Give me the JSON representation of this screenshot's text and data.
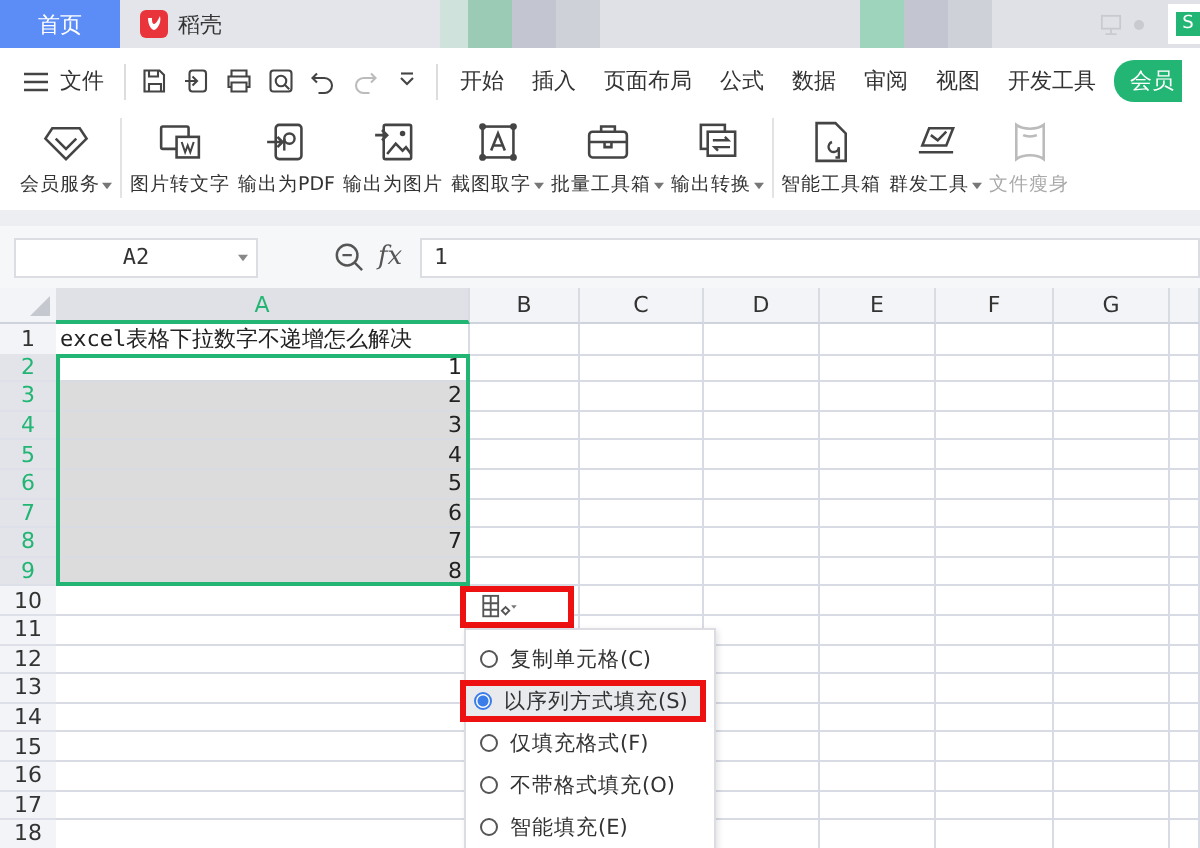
{
  "tabs": [
    {
      "label": "首页",
      "selected": true
    },
    {
      "label": "稻壳",
      "selected": false
    }
  ],
  "app_badge": "S",
  "menu": {
    "file": "文件",
    "tabs": [
      "开始",
      "插入",
      "页面布局",
      "公式",
      "数据",
      "审阅",
      "视图",
      "开发工具"
    ],
    "member": "会员"
  },
  "ribbon": [
    {
      "label": "会员服务",
      "dropdown": true,
      "disabled": false
    },
    {
      "label": "图片转文字",
      "dropdown": false,
      "disabled": false
    },
    {
      "label": "输出为PDF",
      "dropdown": false,
      "disabled": false
    },
    {
      "label": "输出为图片",
      "dropdown": false,
      "disabled": false
    },
    {
      "label": "截图取字",
      "dropdown": true,
      "disabled": false
    },
    {
      "label": "批量工具箱",
      "dropdown": true,
      "disabled": false
    },
    {
      "label": "输出转换",
      "dropdown": true,
      "disabled": false
    },
    {
      "label": "智能工具箱",
      "dropdown": false,
      "disabled": false
    },
    {
      "label": "群发工具",
      "dropdown": true,
      "disabled": false
    },
    {
      "label": "文件瘦身",
      "dropdown": false,
      "disabled": true
    }
  ],
  "formula_bar": {
    "cell": "A2",
    "fx": "fx",
    "value": "1"
  },
  "sheet": {
    "columns": [
      {
        "label": "A",
        "selected": true
      },
      {
        "label": "B",
        "selected": false
      },
      {
        "label": "C",
        "selected": false
      },
      {
        "label": "D",
        "selected": false
      },
      {
        "label": "E",
        "selected": false
      },
      {
        "label": "F",
        "selected": false
      },
      {
        "label": "G",
        "selected": false
      }
    ],
    "rows": [
      {
        "number": "1",
        "a": "excel表格下拉数字不递增怎么解决",
        "selected": false
      },
      {
        "number": "2",
        "a": "1",
        "selected": true
      },
      {
        "number": "3",
        "a": "2",
        "selected": true
      },
      {
        "number": "4",
        "a": "3",
        "selected": true
      },
      {
        "number": "5",
        "a": "4",
        "selected": true
      },
      {
        "number": "6",
        "a": "5",
        "selected": true
      },
      {
        "number": "7",
        "a": "6",
        "selected": true
      },
      {
        "number": "8",
        "a": "7",
        "selected": true
      },
      {
        "number": "9",
        "a": "8",
        "selected": true
      },
      {
        "number": "10",
        "selected": false
      },
      {
        "number": "11",
        "selected": false
      },
      {
        "number": "12",
        "selected": false
      },
      {
        "number": "13",
        "selected": false
      },
      {
        "number": "14",
        "selected": false
      },
      {
        "number": "15",
        "selected": false
      },
      {
        "number": "16",
        "selected": false
      },
      {
        "number": "17",
        "selected": false
      },
      {
        "number": "18",
        "selected": false
      }
    ]
  },
  "fill_options": {
    "annotated": true,
    "options": [
      {
        "label": "复制单元格(C)",
        "selected": false,
        "annotated": false
      },
      {
        "label": "以序列方式填充(S)",
        "selected": true,
        "annotated": true
      },
      {
        "label": "仅填充格式(F)",
        "selected": false,
        "annotated": false
      },
      {
        "label": "不带格式填充(O)",
        "selected": false,
        "annotated": false
      },
      {
        "label": "智能填充(E)",
        "selected": false,
        "annotated": false
      }
    ]
  }
}
